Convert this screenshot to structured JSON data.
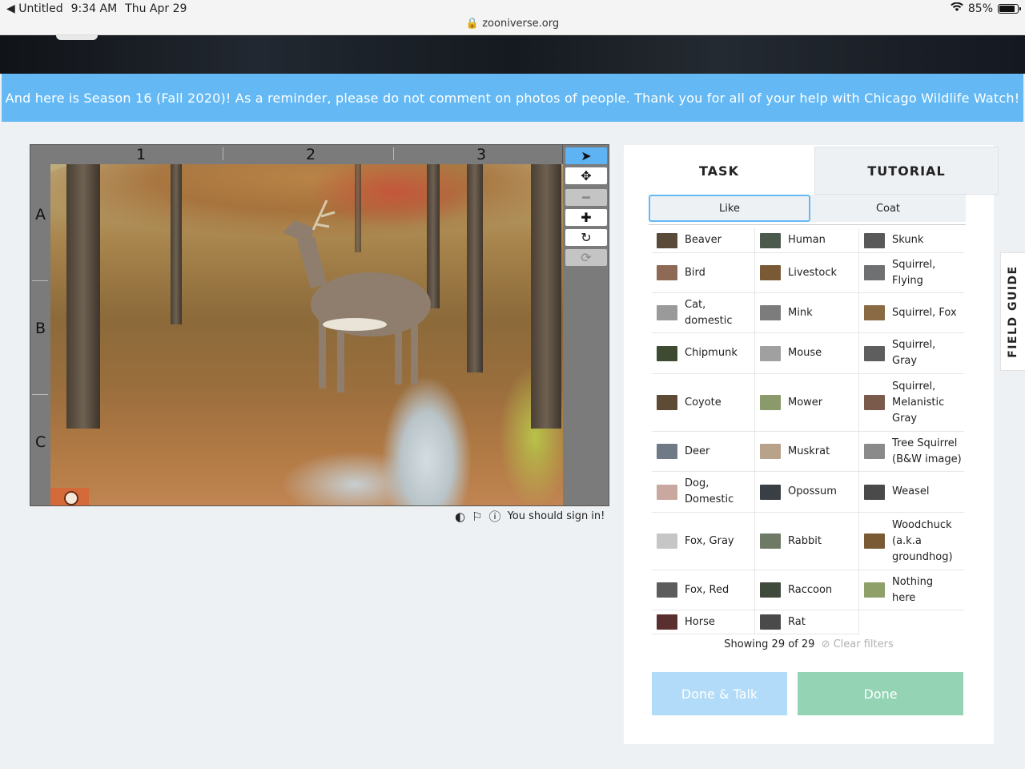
{
  "status_bar": {
    "back_app": "Untitled",
    "time": "9:34 AM",
    "date": "Thu Apr 29",
    "url": "zooniverse.org",
    "battery": "85%",
    "battery_level": 0.85
  },
  "announcement": "And here is Season 16 (Fall 2020)! As a reminder, please do not comment on photos of people. Thank you for all of your help with Chicago Wildlife Watch!",
  "viewer": {
    "columns": [
      "1",
      "2",
      "3"
    ],
    "rows": [
      "A",
      "B",
      "C"
    ],
    "sign_in_text": "You should sign in!"
  },
  "tabs": {
    "task": "TASK",
    "tutorial": "TUTORIAL"
  },
  "subtabs": {
    "like": "Like",
    "coat": "Coat"
  },
  "choices": [
    {
      "label": "Beaver",
      "thumb": "#5a4a3a"
    },
    {
      "label": "Human",
      "thumb": "#4b5a4c"
    },
    {
      "label": "Skunk",
      "thumb": "#595959"
    },
    {
      "label": "Bird",
      "thumb": "#8e6a56"
    },
    {
      "label": "Livestock",
      "thumb": "#7a5a35"
    },
    {
      "label": "Squirrel,\nFlying",
      "thumb": "#6e7072"
    },
    {
      "label": "Cat,\ndomestic",
      "thumb": "#9a9a9a"
    },
    {
      "label": "Mink",
      "thumb": "#7c7c7c"
    },
    {
      "label": "Squirrel, Fox",
      "thumb": "#8a6a45"
    },
    {
      "label": "Chipmunk",
      "thumb": "#3f4a32"
    },
    {
      "label": "Mouse",
      "thumb": "#a0a0a0"
    },
    {
      "label": "Squirrel,\nGray",
      "thumb": "#5e5e5e"
    },
    {
      "label": "Coyote",
      "thumb": "#5d4b35"
    },
    {
      "label": "Mower",
      "thumb": "#8a9a6a"
    },
    {
      "label": "Squirrel,\nMelanistic\nGray",
      "thumb": "#7a5a4a"
    },
    {
      "label": "Deer",
      "thumb": "#6f7a86"
    },
    {
      "label": "Muskrat",
      "thumb": "#b8a28a"
    },
    {
      "label": "Tree Squirrel\n(B&W image)",
      "thumb": "#8a8a8a"
    },
    {
      "label": "Dog,\nDomestic",
      "thumb": "#c9a8a0"
    },
    {
      "label": "Opossum",
      "thumb": "#3a3f45"
    },
    {
      "label": "Weasel",
      "thumb": "#4a4a4a"
    },
    {
      "label": "Fox, Gray",
      "thumb": "#c6c6c6"
    },
    {
      "label": "Rabbit",
      "thumb": "#6f7a66"
    },
    {
      "label": "Woodchuck\n(a.k.a\ngroundhog)",
      "thumb": "#7a5a35"
    },
    {
      "label": "Fox, Red",
      "thumb": "#5c5c5c"
    },
    {
      "label": "Raccoon",
      "thumb": "#3f4a3c"
    },
    {
      "label": "Nothing\nhere",
      "thumb": "#8fa06a"
    },
    {
      "label": "Horse",
      "thumb": "#5a2f2f"
    },
    {
      "label": "Rat",
      "thumb": "#4a4a4a"
    }
  ],
  "showing_text": "Showing 29 of 29",
  "clear_filters": "Clear filters",
  "buttons": {
    "done_talk": "Done & Talk",
    "done": "Done"
  },
  "field_guide": "FIELD GUIDE",
  "colors": {
    "accent": "#64b9f5",
    "done": "#94d3b4",
    "done_talk": "#b1dbf8"
  }
}
